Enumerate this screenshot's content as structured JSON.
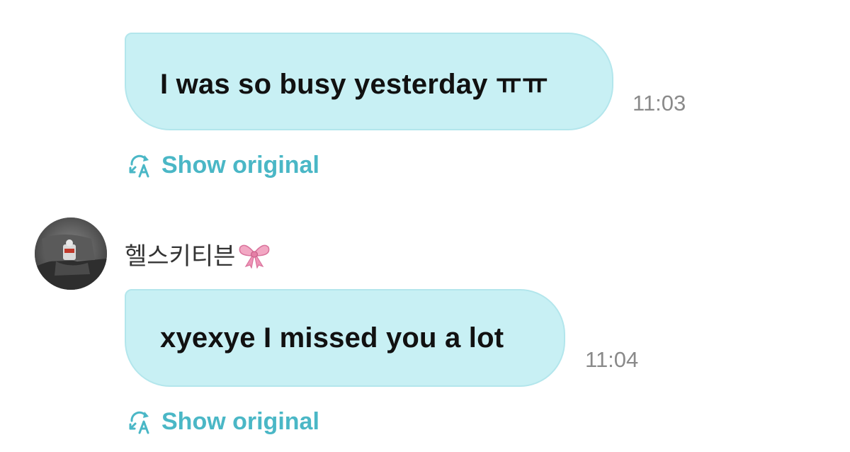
{
  "messages": [
    {
      "text": "I was so busy yesterday ㅠㅠ",
      "time": "11:03",
      "show_original": "Show original",
      "icon": "translate-icon"
    },
    {
      "text": "xyexye I missed you a lot",
      "time": "11:04",
      "show_original": "Show original",
      "icon": "translate-icon"
    }
  ],
  "sender": {
    "name": "헬스키티븐",
    "emoji": "ribbon-bow-icon",
    "avatar": "avatar-photo"
  },
  "colors": {
    "bubble": "#c8f0f4",
    "bubble_border": "#b3e6ec",
    "link": "#4ab7c6",
    "time": "#8a8a8a",
    "text": "#111111"
  }
}
